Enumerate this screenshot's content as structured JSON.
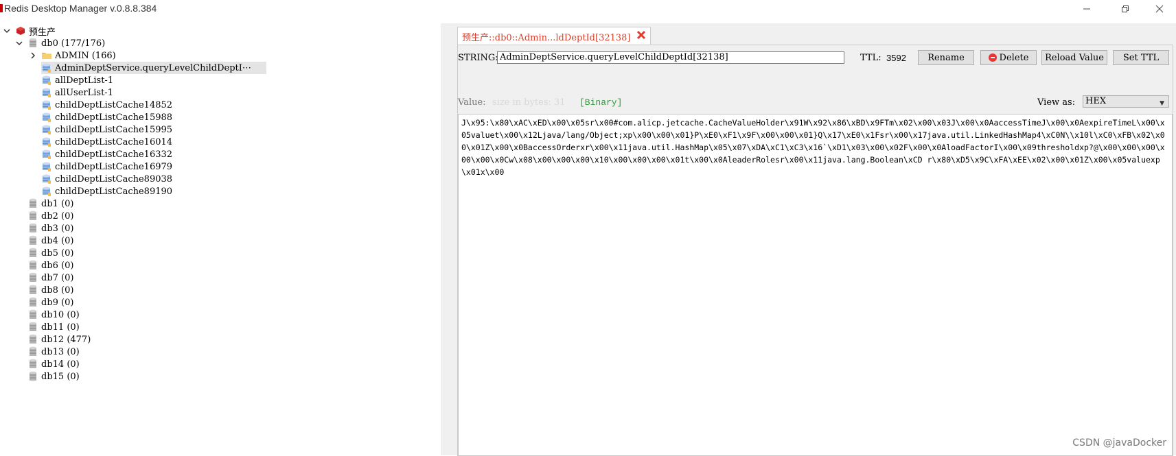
{
  "window": {
    "title": "Redis Desktop Manager v.0.8.8.384"
  },
  "tree": {
    "connection": "预生产",
    "db0": {
      "label": "db0  (177/176)",
      "folder": "ADMIN (166)",
      "keys": [
        "AdminDeptService.queryLevelChildDeptI⋯",
        "allDeptList-1",
        "allUserList-1",
        "childDeptListCache14852",
        "childDeptListCache15988",
        "childDeptListCache15995",
        "childDeptListCache16014",
        "childDeptListCache16332",
        "childDeptListCache16979",
        "childDeptListCache89038",
        "childDeptListCache89190"
      ]
    },
    "dbs": [
      "db1 (0)",
      "db2 (0)",
      "db3 (0)",
      "db4 (0)",
      "db5 (0)",
      "db6 (0)",
      "db7 (0)",
      "db8 (0)",
      "db9 (0)",
      "db10 (0)",
      "db11 (0)",
      "db12 (477)",
      "db13 (0)",
      "db14 (0)",
      "db15 (0)"
    ]
  },
  "tab": {
    "label": "预生产::db0::Admin...ldDeptId[32138]"
  },
  "editor": {
    "type_label": "STRING:",
    "key_value": "AdminDeptService.queryLevelChildDeptId[32138]",
    "ttl_label": "TTL:",
    "ttl_value": "3592",
    "rename": "Rename",
    "delete": "Delete",
    "reload": "Reload Value",
    "set_ttl": "Set TTL",
    "value_label": "Value:",
    "size_hint": "size in bytes: 31",
    "binary_tag": "[Binary]",
    "view_as_label": "View as:",
    "view_as_value": "HEX",
    "value_text": "J\\x95:\\x80\\xAC\\xED\\x00\\x05sr\\x00#com.alicp.jetcache.CacheValueHolder\\x91W\\x92\\x86\\xBD\\x9FTm\\x02\\x00\\x03J\\x00\\x0AaccessTimeJ\\x00\\x0AexpireTimeL\\x00\\x05valuet\\x00\\x12Ljava/lang/Object;xp\\x00\\x00\\x01}P\\xE0\\xF1\\x9F\\x00\\x00\\x01}Q\\x17\\xE0\\x1Fsr\\x00\\x17java.util.LinkedHashMap4\\xC0N\\\\x10l\\xC0\\xFB\\x02\\x00\\x01Z\\x00\\x0BaccessOrderxr\\x00\\x11java.util.HashMap\\x05\\x07\\xDA\\xC1\\xC3\\x16`\\xD1\\x03\\x00\\x02F\\x00\\x0AloadFactorI\\x00\\x09thresholdxp?@\\x00\\x00\\x00\\x00\\x00\\x0Cw\\x08\\x00\\x00\\x00\\x10\\x00\\x00\\x00\\x01t\\x00\\x0AleaderRolesr\\x00\\x11java.lang.Boolean\\xCD r\\x80\\xD5\\x9C\\xFA\\xEE\\x02\\x00\\x01Z\\x00\\x05valuexp\\x01x\\x00"
  },
  "watermark": "CSDN @javaDocker",
  "colors": {
    "accent_red": "#d6402c",
    "binary_green": "#2e9e3a",
    "db_icon": "#9a9a9a",
    "key_icon": "#5b8bd1",
    "folder_icon": "#f2c04a"
  }
}
